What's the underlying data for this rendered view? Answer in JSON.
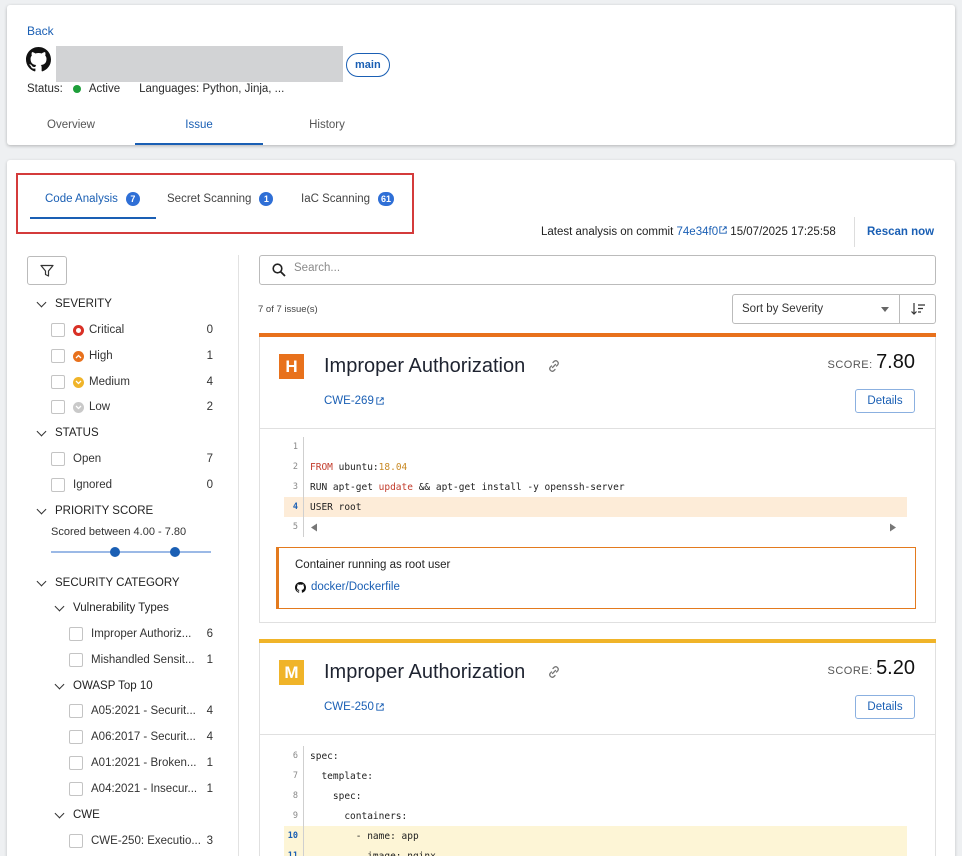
{
  "header": {
    "back_label": "Back",
    "branch": "main",
    "status_label": "Status:",
    "status_value": "Active",
    "languages": "Languages: Python, Jinja, ...",
    "tabs": [
      {
        "label": "Overview"
      },
      {
        "label": "Issue"
      },
      {
        "label": "History"
      }
    ],
    "active_tab": "Issue"
  },
  "scan_tabs": [
    {
      "label": "Code Analysis",
      "count": "7"
    },
    {
      "label": "Secret Scanning",
      "count": "1"
    },
    {
      "label": "IaC Scanning",
      "count": "61"
    }
  ],
  "analysis": {
    "prefix": "Latest analysis on commit",
    "commit": "74e34f0",
    "datetime": "15/07/2025 17:25:58",
    "rescan_label": "Rescan now"
  },
  "filters": {
    "severity": {
      "title": "SEVERITY",
      "items": [
        {
          "label": "Critical",
          "count": "0",
          "color": "#d93025"
        },
        {
          "label": "High",
          "count": "1",
          "color": "#e8711c"
        },
        {
          "label": "Medium",
          "count": "4",
          "color": "#f0b429"
        },
        {
          "label": "Low",
          "count": "2",
          "color": "#c9c9c9"
        }
      ]
    },
    "status": {
      "title": "STATUS",
      "items": [
        {
          "label": "Open",
          "count": "7"
        },
        {
          "label": "Ignored",
          "count": "0"
        }
      ]
    },
    "priority": {
      "title": "PRIORITY SCORE",
      "range_text": "Scored between 4.00 - 7.80",
      "low": 4.0,
      "high": 7.8
    },
    "security_category": {
      "title": "SECURITY CATEGORY",
      "groups": [
        {
          "title": "Vulnerability Types",
          "items": [
            {
              "label": "Improper Authoriz...",
              "count": "6"
            },
            {
              "label": "Mishandled Sensit...",
              "count": "1"
            }
          ]
        },
        {
          "title": "OWASP Top 10",
          "items": [
            {
              "label": "A05:2021 - Securit...",
              "count": "4"
            },
            {
              "label": "A06:2017 - Securit...",
              "count": "4"
            },
            {
              "label": "A01:2021 - Broken...",
              "count": "1"
            },
            {
              "label": "A04:2021 - Insecur...",
              "count": "1"
            }
          ]
        },
        {
          "title": "CWE",
          "items": [
            {
              "label": "CWE-250: Executio...",
              "count": "3"
            }
          ]
        }
      ]
    }
  },
  "search": {
    "placeholder": "Search..."
  },
  "results": {
    "count_text": "7 of 7 issue(s)",
    "sort_label": "Sort by Severity"
  },
  "issues": [
    {
      "severity_letter": "H",
      "severity_color": "#e8711c",
      "title": "Improper Authorization",
      "score_label": "SCORE:",
      "score": "7.80",
      "cwe": "CWE-269",
      "details_label": "Details",
      "finding_message": "Container running as root user",
      "file": "docker/Dockerfile"
    },
    {
      "severity_letter": "M",
      "severity_color": "#f0b429",
      "title": "Improper Authorization",
      "score_label": "SCORE:",
      "score": "5.20",
      "cwe": "CWE-250",
      "details_label": "Details"
    }
  ]
}
